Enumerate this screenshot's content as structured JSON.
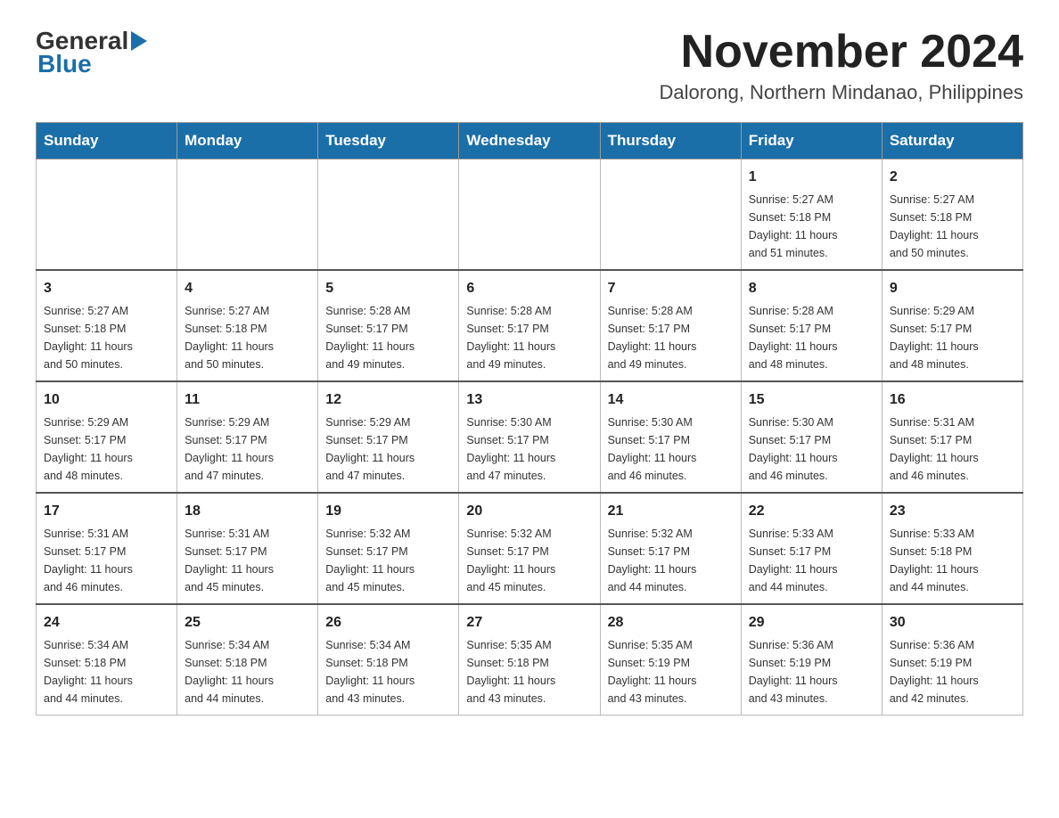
{
  "logo": {
    "general": "General",
    "blue": "Blue",
    "triangle": "▶"
  },
  "title": "November 2024",
  "subtitle": "Dalorong, Northern Mindanao, Philippines",
  "days_of_week": [
    "Sunday",
    "Monday",
    "Tuesday",
    "Wednesday",
    "Thursday",
    "Friday",
    "Saturday"
  ],
  "weeks": [
    [
      {
        "day": "",
        "info": ""
      },
      {
        "day": "",
        "info": ""
      },
      {
        "day": "",
        "info": ""
      },
      {
        "day": "",
        "info": ""
      },
      {
        "day": "",
        "info": ""
      },
      {
        "day": "1",
        "info": "Sunrise: 5:27 AM\nSunset: 5:18 PM\nDaylight: 11 hours\nand 51 minutes."
      },
      {
        "day": "2",
        "info": "Sunrise: 5:27 AM\nSunset: 5:18 PM\nDaylight: 11 hours\nand 50 minutes."
      }
    ],
    [
      {
        "day": "3",
        "info": "Sunrise: 5:27 AM\nSunset: 5:18 PM\nDaylight: 11 hours\nand 50 minutes."
      },
      {
        "day": "4",
        "info": "Sunrise: 5:27 AM\nSunset: 5:18 PM\nDaylight: 11 hours\nand 50 minutes."
      },
      {
        "day": "5",
        "info": "Sunrise: 5:28 AM\nSunset: 5:17 PM\nDaylight: 11 hours\nand 49 minutes."
      },
      {
        "day": "6",
        "info": "Sunrise: 5:28 AM\nSunset: 5:17 PM\nDaylight: 11 hours\nand 49 minutes."
      },
      {
        "day": "7",
        "info": "Sunrise: 5:28 AM\nSunset: 5:17 PM\nDaylight: 11 hours\nand 49 minutes."
      },
      {
        "day": "8",
        "info": "Sunrise: 5:28 AM\nSunset: 5:17 PM\nDaylight: 11 hours\nand 48 minutes."
      },
      {
        "day": "9",
        "info": "Sunrise: 5:29 AM\nSunset: 5:17 PM\nDaylight: 11 hours\nand 48 minutes."
      }
    ],
    [
      {
        "day": "10",
        "info": "Sunrise: 5:29 AM\nSunset: 5:17 PM\nDaylight: 11 hours\nand 48 minutes."
      },
      {
        "day": "11",
        "info": "Sunrise: 5:29 AM\nSunset: 5:17 PM\nDaylight: 11 hours\nand 47 minutes."
      },
      {
        "day": "12",
        "info": "Sunrise: 5:29 AM\nSunset: 5:17 PM\nDaylight: 11 hours\nand 47 minutes."
      },
      {
        "day": "13",
        "info": "Sunrise: 5:30 AM\nSunset: 5:17 PM\nDaylight: 11 hours\nand 47 minutes."
      },
      {
        "day": "14",
        "info": "Sunrise: 5:30 AM\nSunset: 5:17 PM\nDaylight: 11 hours\nand 46 minutes."
      },
      {
        "day": "15",
        "info": "Sunrise: 5:30 AM\nSunset: 5:17 PM\nDaylight: 11 hours\nand 46 minutes."
      },
      {
        "day": "16",
        "info": "Sunrise: 5:31 AM\nSunset: 5:17 PM\nDaylight: 11 hours\nand 46 minutes."
      }
    ],
    [
      {
        "day": "17",
        "info": "Sunrise: 5:31 AM\nSunset: 5:17 PM\nDaylight: 11 hours\nand 46 minutes."
      },
      {
        "day": "18",
        "info": "Sunrise: 5:31 AM\nSunset: 5:17 PM\nDaylight: 11 hours\nand 45 minutes."
      },
      {
        "day": "19",
        "info": "Sunrise: 5:32 AM\nSunset: 5:17 PM\nDaylight: 11 hours\nand 45 minutes."
      },
      {
        "day": "20",
        "info": "Sunrise: 5:32 AM\nSunset: 5:17 PM\nDaylight: 11 hours\nand 45 minutes."
      },
      {
        "day": "21",
        "info": "Sunrise: 5:32 AM\nSunset: 5:17 PM\nDaylight: 11 hours\nand 44 minutes."
      },
      {
        "day": "22",
        "info": "Sunrise: 5:33 AM\nSunset: 5:17 PM\nDaylight: 11 hours\nand 44 minutes."
      },
      {
        "day": "23",
        "info": "Sunrise: 5:33 AM\nSunset: 5:18 PM\nDaylight: 11 hours\nand 44 minutes."
      }
    ],
    [
      {
        "day": "24",
        "info": "Sunrise: 5:34 AM\nSunset: 5:18 PM\nDaylight: 11 hours\nand 44 minutes."
      },
      {
        "day": "25",
        "info": "Sunrise: 5:34 AM\nSunset: 5:18 PM\nDaylight: 11 hours\nand 44 minutes."
      },
      {
        "day": "26",
        "info": "Sunrise: 5:34 AM\nSunset: 5:18 PM\nDaylight: 11 hours\nand 43 minutes."
      },
      {
        "day": "27",
        "info": "Sunrise: 5:35 AM\nSunset: 5:18 PM\nDaylight: 11 hours\nand 43 minutes."
      },
      {
        "day": "28",
        "info": "Sunrise: 5:35 AM\nSunset: 5:19 PM\nDaylight: 11 hours\nand 43 minutes."
      },
      {
        "day": "29",
        "info": "Sunrise: 5:36 AM\nSunset: 5:19 PM\nDaylight: 11 hours\nand 43 minutes."
      },
      {
        "day": "30",
        "info": "Sunrise: 5:36 AM\nSunset: 5:19 PM\nDaylight: 11 hours\nand 42 minutes."
      }
    ]
  ]
}
